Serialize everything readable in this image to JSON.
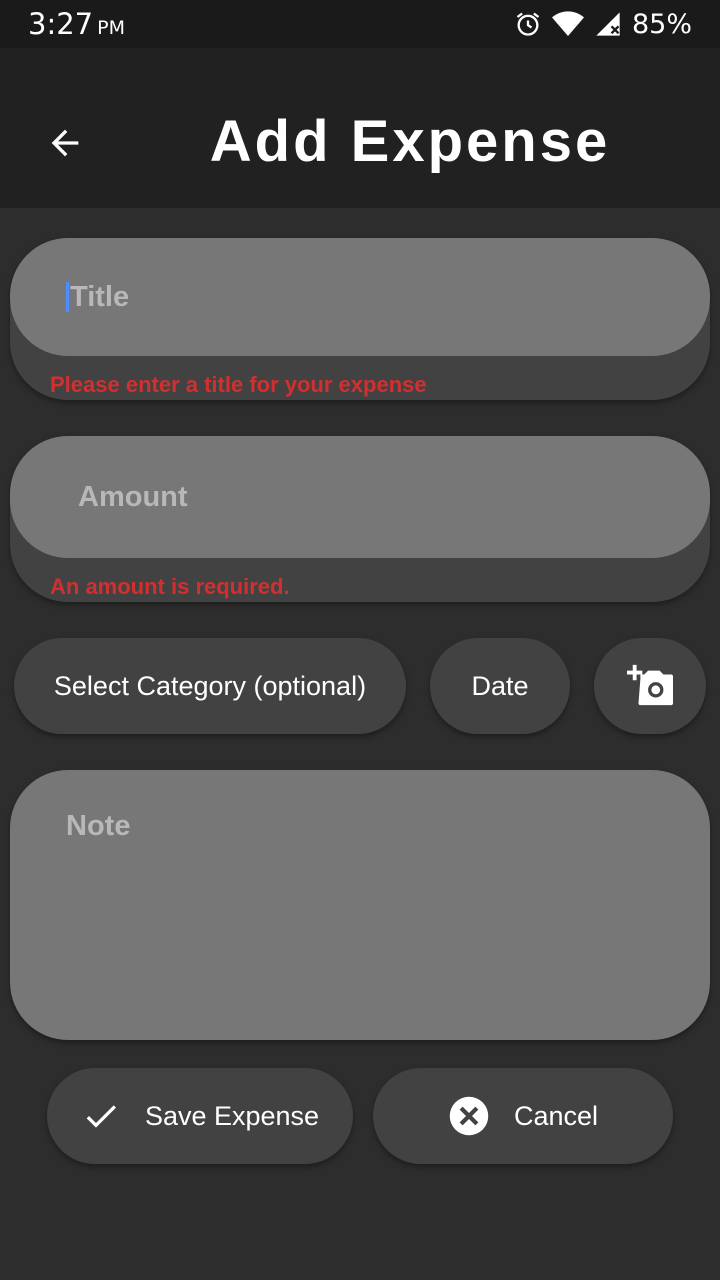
{
  "status_bar": {
    "time": "3:27",
    "ampm": "PM",
    "battery": "85%"
  },
  "header": {
    "title": "Add Expense"
  },
  "form": {
    "title": {
      "placeholder": "Title",
      "error": "Please enter a title for your expense"
    },
    "amount": {
      "placeholder": "Amount",
      "error": "An amount is required."
    },
    "category_label": "Select Category (optional)",
    "date_label": "Date",
    "note_placeholder": "Note"
  },
  "actions": {
    "save_label": "Save Expense",
    "cancel_label": "Cancel"
  },
  "icons": {
    "back": "arrow-left-icon",
    "camera": "add-a-photo-icon",
    "save": "check-icon",
    "cancel": "cancel-circle-icon",
    "alarm": "alarm-icon",
    "wifi": "wifi-icon",
    "signal": "signal-icon"
  },
  "colors": {
    "error": "#d32f2f",
    "field": "#777777",
    "surface": "#424242",
    "background": "#2d2d2d"
  }
}
